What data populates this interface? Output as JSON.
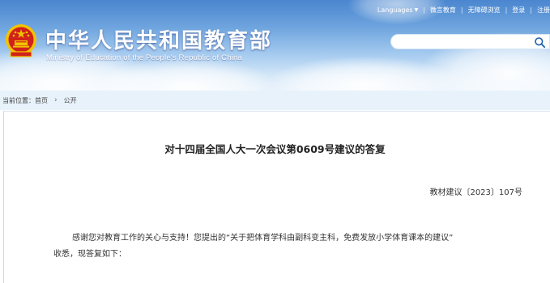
{
  "header": {
    "title_cn": "中华人民共和国教育部",
    "title_en": "Ministry of Education of the People's Republic of China",
    "emblem_icon": "national-emblem-icon",
    "colors": {
      "sky_top": "#4a86cf",
      "sky_bottom": "#e6f1fb",
      "emblem_red": "#d0211b",
      "emblem_gold": "#f2c300"
    }
  },
  "topbar": {
    "languages": "Languages",
    "languages_icon": "chevron-down-icon",
    "links": [
      "微言教育",
      "无障碍浏览",
      "登录",
      "注册"
    ],
    "separator": "|"
  },
  "search": {
    "placeholder": "",
    "icon": "search-icon"
  },
  "breadcrumb": {
    "label": "当前位置：",
    "items": [
      "首页",
      "公开"
    ],
    "arrow_icon": "chevron-right-icon"
  },
  "document": {
    "title": "对十四届全国人大一次会议第0609号建议的答复",
    "number": "教材建议〔2023〕107号",
    "paragraph_line1": "感谢您对教育工作的关心与支持！您提出的“关于把体育学科由副科变主科，免费发放小学体育课本的建议”",
    "paragraph_line2": "收悉，现答复如下："
  }
}
